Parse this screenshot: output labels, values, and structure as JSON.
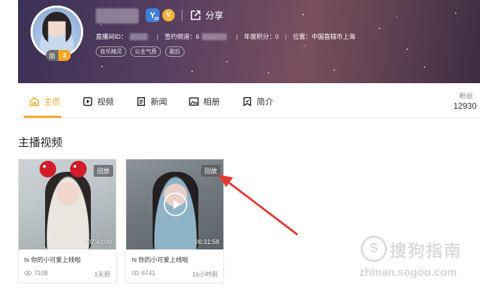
{
  "profile": {
    "level_prefix": "勋",
    "level": "3",
    "badge_y": "Y",
    "badge_y_sub": "20",
    "badge_v": "V",
    "share_label": "分享",
    "room_id_label": "直播间ID：",
    "channel_label": "签约频道：6",
    "score_label": "年度积分：0",
    "location_label": "位置：中国直辖市上海",
    "tags": [
      "音乐精灵",
      "公主气质",
      "歌后"
    ]
  },
  "nav": {
    "tabs": [
      {
        "label": "主页",
        "icon": "home-icon"
      },
      {
        "label": "视频",
        "icon": "video-icon"
      },
      {
        "label": "新闻",
        "icon": "news-icon"
      },
      {
        "label": "相册",
        "icon": "album-icon"
      },
      {
        "label": "简介",
        "icon": "profile-icon"
      }
    ],
    "fans_label": "粉丝",
    "fans_count": "12930"
  },
  "section_title": "主播视频",
  "videos": [
    {
      "replay": "回放",
      "duration": "07:43:00",
      "title": "hi 你的小可爱上线啦",
      "views": "7108",
      "time_ago": "1天前"
    },
    {
      "replay": "回放",
      "duration": "06:31:58",
      "title": "hi 你的小可爱上线啦",
      "views": "6741",
      "time_ago": "16小时前"
    }
  ],
  "watermark": {
    "logo": "S",
    "text": "搜狗指南",
    "url": "zhinan.sogou.com"
  },
  "colors": {
    "accent": "#f5a623",
    "annotation_arrow": "#e53935"
  }
}
